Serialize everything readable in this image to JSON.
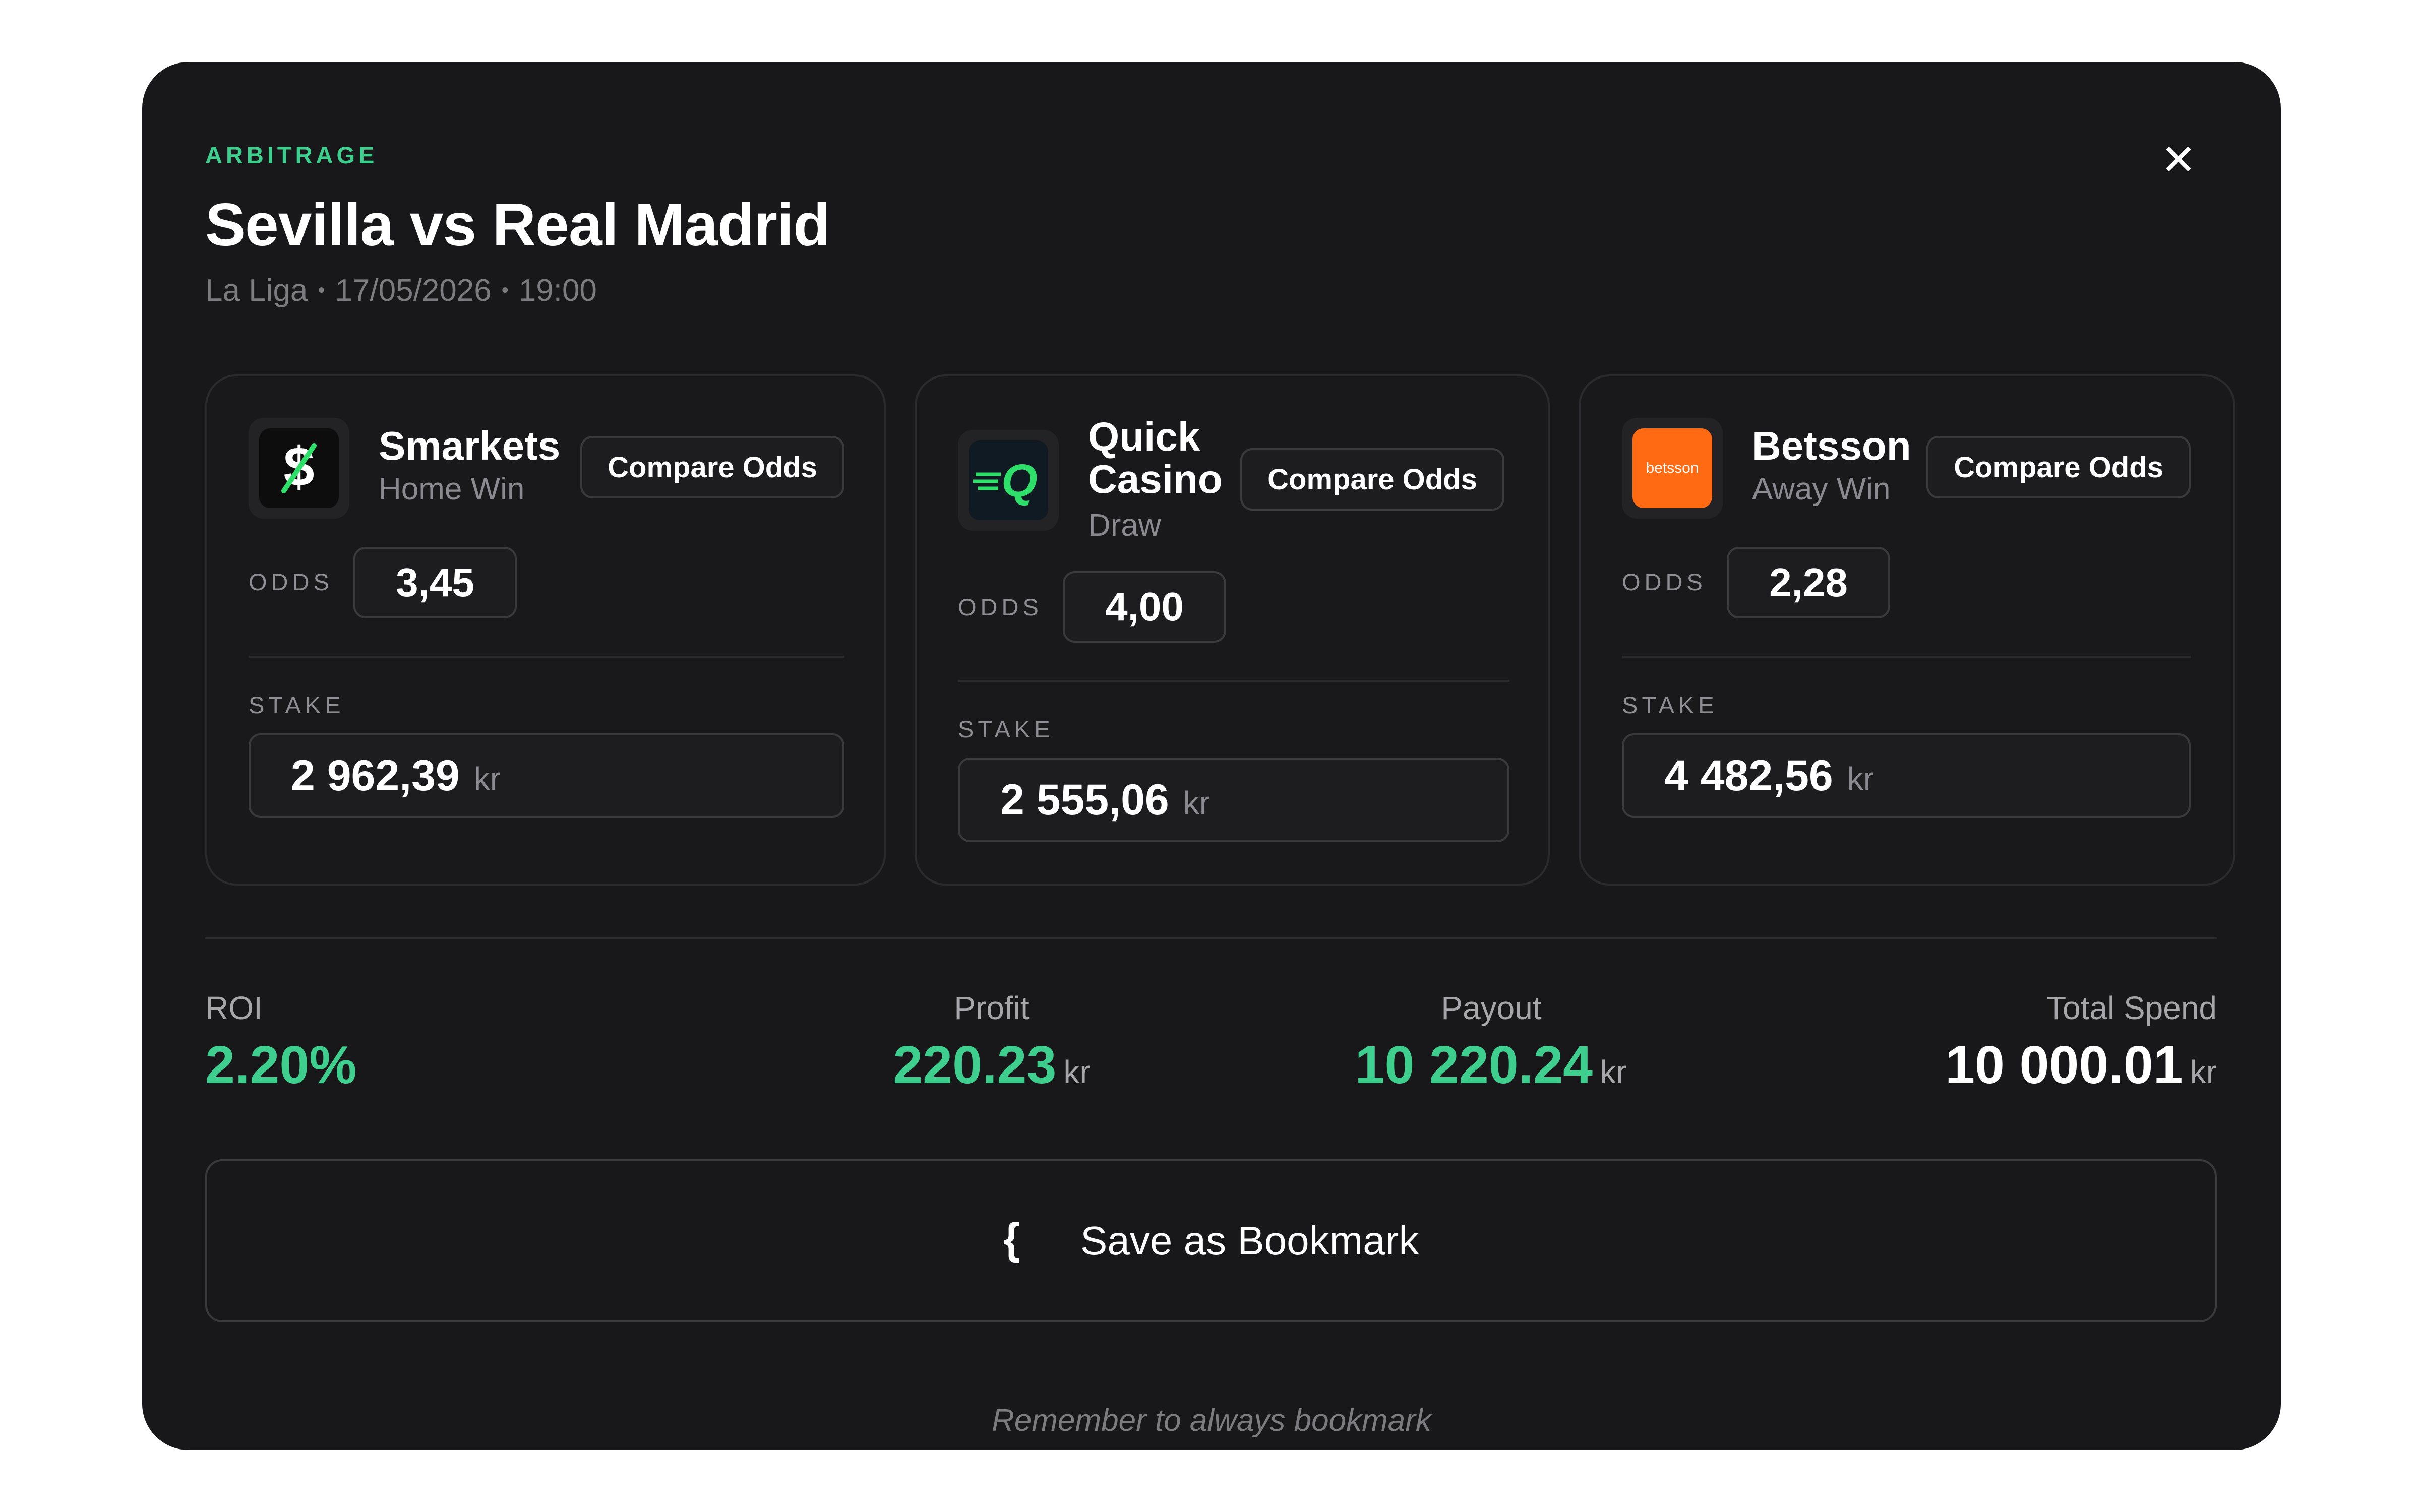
{
  "header": {
    "eyebrow": "ARBITRAGE",
    "title": "Sevilla vs Real Madrid",
    "league": "La Liga",
    "date": "17/05/2026",
    "time": "19:00",
    "separator": "•",
    "close_icon": "✕"
  },
  "colors": {
    "accent": "#3ecf8e",
    "smarkets_logo_bg": "#0d0d0d",
    "quickcasino_logo_bg": "#101a22",
    "quickcasino_logo_accent": "#2ee06a",
    "betsson_logo_bg": "#ff6a13"
  },
  "bets": [
    {
      "bookmaker": "Smarkets",
      "outcome": "Home Win",
      "logo_icon": "smarkets-logo",
      "logo_glyph": "$",
      "compare_label": "Compare Odds",
      "odds_label": "ODDS",
      "odds": "3,45",
      "stake_label": "STAKE",
      "stake": "2 962,39",
      "currency": "kr"
    },
    {
      "bookmaker_line1": "Quick",
      "bookmaker_line2": "Casino",
      "outcome": "Draw",
      "logo_icon": "quick-casino-logo",
      "logo_glyph": "Q",
      "compare_label": "Compare Odds",
      "odds_label": "ODDS",
      "odds": "4,00",
      "stake_label": "STAKE",
      "stake": "2 555,06",
      "currency": "kr"
    },
    {
      "bookmaker": "Betsson",
      "outcome": "Away Win",
      "logo_icon": "betsson-logo",
      "logo_glyph": "betsson",
      "compare_label": "Compare Odds",
      "odds_label": "ODDS",
      "odds": "2,28",
      "stake_label": "STAKE",
      "stake": "4 482,56",
      "currency": "kr"
    }
  ],
  "summary": {
    "roi_label": "ROI",
    "roi": "2.20%",
    "profit_label": "Profit",
    "profit": "220.23",
    "payout_label": "Payout",
    "payout": "10 220.24",
    "total_label": "Total Spend",
    "total": "10 000.01",
    "currency": "kr"
  },
  "bookmark": {
    "icon": "{",
    "label": "Save as Bookmark",
    "note": "Remember to always bookmark"
  }
}
